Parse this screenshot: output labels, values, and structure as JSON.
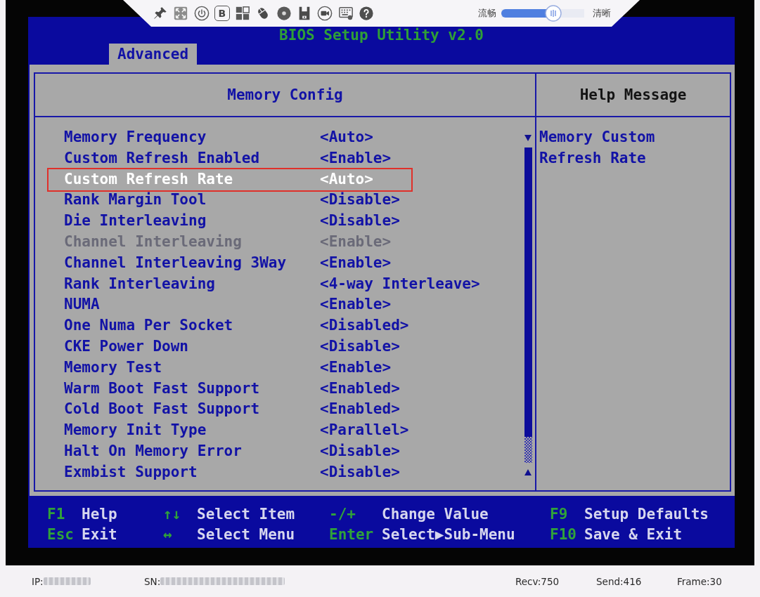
{
  "toolbar": {
    "b_button": "B",
    "speed_label": "流畅",
    "quality_label": "清晰",
    "quality_slider": {
      "level": 0.63
    }
  },
  "bios": {
    "title": "BIOS Setup Utility v2.0",
    "tabs": [
      {
        "label": "Advanced",
        "selected": true
      }
    ],
    "panel_title": "Memory Config",
    "items": [
      {
        "label": "Memory Frequency",
        "value": "<Auto>",
        "selected": false,
        "disabled": false,
        "marked": false
      },
      {
        "label": "Custom Refresh Enabled",
        "value": "<Enable>",
        "selected": false,
        "disabled": false,
        "marked": false
      },
      {
        "label": "Custom Refresh Rate",
        "value": "<Auto>",
        "selected": true,
        "disabled": false,
        "marked": true
      },
      {
        "label": "Rank Margin Tool",
        "value": "<Disable>",
        "selected": false,
        "disabled": false,
        "marked": false
      },
      {
        "label": "Die Interleaving",
        "value": "<Disable>",
        "selected": false,
        "disabled": false,
        "marked": false
      },
      {
        "label": "Channel Interleaving",
        "value": "<Enable>",
        "selected": false,
        "disabled": true,
        "marked": false
      },
      {
        "label": "Channel Interleaving 3Way",
        "value": "<Enable>",
        "selected": false,
        "disabled": false,
        "marked": false
      },
      {
        "label": "Rank Interleaving",
        "value": "<4-way Interleave>",
        "selected": false,
        "disabled": false,
        "marked": false
      },
      {
        "label": "NUMA",
        "value": "<Enable>",
        "selected": false,
        "disabled": false,
        "marked": false
      },
      {
        "label": "One Numa Per Socket",
        "value": "<Disabled>",
        "selected": false,
        "disabled": false,
        "marked": false
      },
      {
        "label": "CKE Power Down",
        "value": "<Disable>",
        "selected": false,
        "disabled": false,
        "marked": false
      },
      {
        "label": "Memory Test",
        "value": "<Enable>",
        "selected": false,
        "disabled": false,
        "marked": false
      },
      {
        "label": "Warm Boot Fast Support",
        "value": "<Enabled>",
        "selected": false,
        "disabled": false,
        "marked": false
      },
      {
        "label": "Cold Boot Fast Support",
        "value": "<Enabled>",
        "selected": false,
        "disabled": false,
        "marked": false
      },
      {
        "label": "Memory Init Type",
        "value": "<Parallel>",
        "selected": false,
        "disabled": false,
        "marked": false
      },
      {
        "label": "Halt On Memory Error",
        "value": "<Disable>",
        "selected": false,
        "disabled": false,
        "marked": false
      },
      {
        "label": "Exmbist Support",
        "value": "<Disable>",
        "selected": false,
        "disabled": false,
        "marked": false
      }
    ],
    "help": {
      "title": "Help Message",
      "text": "Memory Custom Refresh Rate"
    },
    "keys": [
      {
        "key": "F1",
        "action": "Help"
      },
      {
        "key": "↑↓",
        "action": "Select Item"
      },
      {
        "key": "-/+",
        "action": "Change Value"
      },
      {
        "key": "F9",
        "action": "Setup Defaults"
      },
      {
        "key": "Esc",
        "action": "Exit"
      },
      {
        "key": "↔",
        "action": "Select Menu"
      },
      {
        "key": "Enter",
        "action": "Select▶Sub-Menu"
      },
      {
        "key": "F10",
        "action": "Save & Exit"
      }
    ]
  },
  "status_bar": {
    "ip_label": "IP:",
    "sn_label": "SN:",
    "recv": "Recv:750",
    "send": "Send:416",
    "frame": "Frame:30"
  }
}
